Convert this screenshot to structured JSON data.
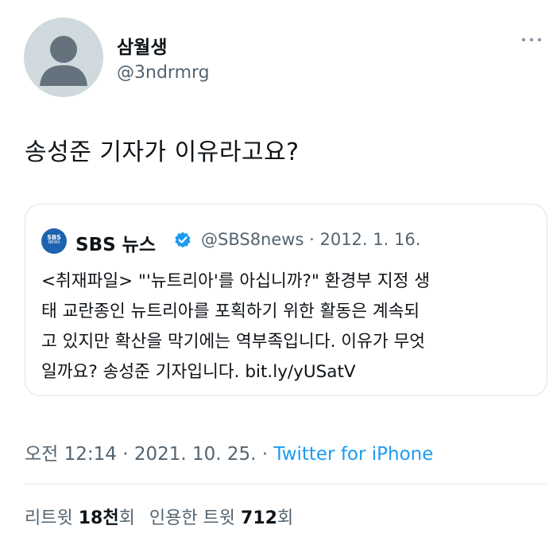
{
  "author": {
    "name": "삼월생",
    "handle": "@3ndrmrg",
    "avatar_icon": "default-profile-icon"
  },
  "more_icon": "more-horizontal-icon",
  "tweet": {
    "text": "송성준 기자가 이유라고요?"
  },
  "quoted": {
    "logo_text": "SBS",
    "logo_sub": "NEWS",
    "name": "SBS 뉴스",
    "verified_icon": "verified-badge-icon",
    "handle": "@SBS8news",
    "separator": "·",
    "date": "2012. 1. 16.",
    "body_lines": [
      "<취재파일> \"'뉴트리아'를 아십니까?\" 환경부 지정 생",
      "태 교란종인 뉴트리아를 포획하기 위한 활동은 계속되",
      "고 있지만 확산을 막기에는 역부족입니다. 이유가 무엇",
      "일까요? 송성준 기자입니다. bit.ly/yUSatV"
    ]
  },
  "meta": {
    "time": "오전 12:14",
    "sep1": "·",
    "date": "2021. 10. 25.",
    "sep2": "·",
    "source": "Twitter for iPhone"
  },
  "stats": {
    "retweets_label": "리트윗",
    "retweets_value": "18천",
    "retweets_suffix": "회",
    "quotes_label": "인용한 트윗",
    "quotes_value": "712",
    "quotes_suffix": "회"
  },
  "colors": {
    "text": "#0f1419",
    "secondary": "#536471",
    "link": "#1d9bf0",
    "verified": "#1d9bf0",
    "sbs_blue": "#1d62b0",
    "border": "#dfe4e8"
  }
}
